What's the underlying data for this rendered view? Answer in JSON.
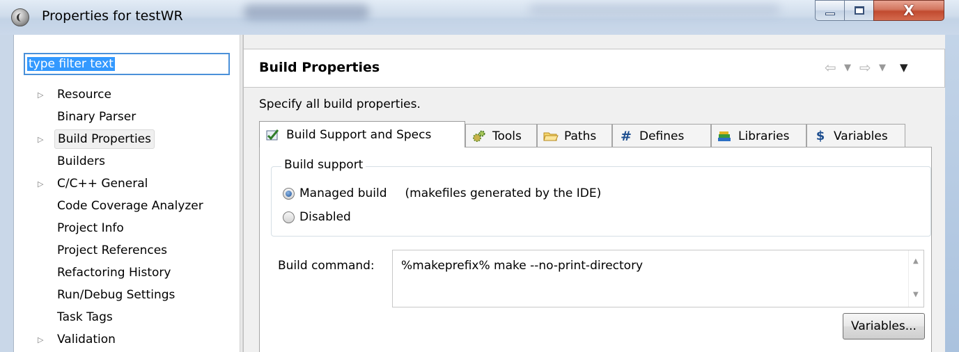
{
  "window": {
    "title": "Properties for testWR",
    "minimize_icon": "minimize-icon",
    "maximize_icon": "maximize-icon",
    "close_glyph": "X"
  },
  "filter": {
    "value": "type filter text"
  },
  "tree": {
    "items": [
      {
        "label": "Resource",
        "expandable": true
      },
      {
        "label": "Binary Parser",
        "expandable": false
      },
      {
        "label": "Build Properties",
        "expandable": true,
        "selected": true
      },
      {
        "label": "Builders",
        "expandable": false
      },
      {
        "label": "C/C++ General",
        "expandable": true
      },
      {
        "label": "Code Coverage Analyzer",
        "expandable": false
      },
      {
        "label": "Project Info",
        "expandable": false
      },
      {
        "label": "Project References",
        "expandable": false
      },
      {
        "label": "Refactoring History",
        "expandable": false
      },
      {
        "label": "Run/Debug Settings",
        "expandable": false
      },
      {
        "label": "Task Tags",
        "expandable": false
      },
      {
        "label": "Validation",
        "expandable": true
      }
    ]
  },
  "page": {
    "title": "Build Properties",
    "description": "Specify all build properties."
  },
  "tabs": [
    {
      "label": "Build Support and Specs",
      "icon": "checklist-icon",
      "active": true
    },
    {
      "label": "Tools",
      "icon": "gears-icon"
    },
    {
      "label": "Paths",
      "icon": "folder-icon"
    },
    {
      "label": "Defines",
      "icon": "hash-icon",
      "glyph": "#"
    },
    {
      "label": "Libraries",
      "icon": "books-icon"
    },
    {
      "label": "Variables",
      "icon": "dollar-icon",
      "glyph": "$"
    }
  ],
  "build_support": {
    "legend": "Build support",
    "managed_label": "Managed build",
    "managed_note": "(makefiles generated by the IDE)",
    "disabled_label": "Disabled",
    "selected": "managed"
  },
  "build_command": {
    "label": "Build command:",
    "value": "%makeprefix% make --no-print-directory"
  },
  "variables_button": "Variables...",
  "colors": {
    "selection": "#3399ff",
    "close_button": "#c14a2f",
    "titlebar": "#cfdceb"
  }
}
